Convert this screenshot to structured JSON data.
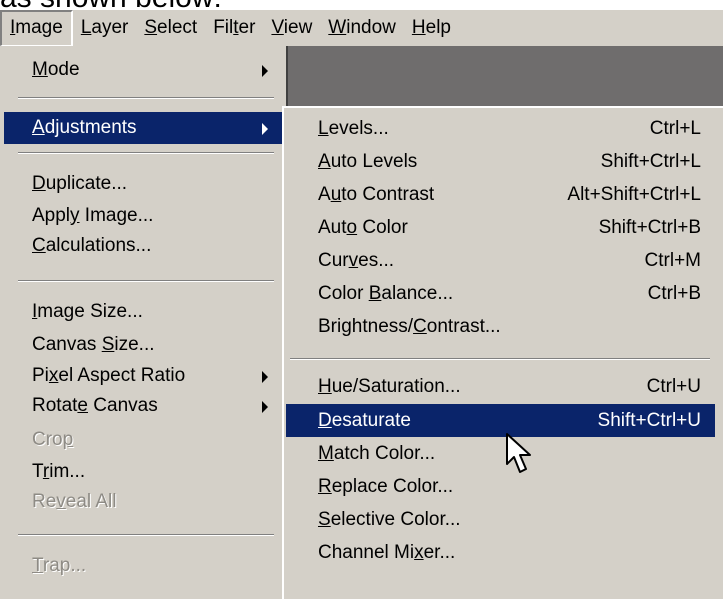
{
  "caption": "as shown below:",
  "menubar": {
    "items": [
      {
        "before": "",
        "key": "I",
        "after": "mage"
      },
      {
        "before": "",
        "key": "L",
        "after": "ayer"
      },
      {
        "before": "",
        "key": "S",
        "after": "elect"
      },
      {
        "before": "Fil",
        "key": "t",
        "after": "er"
      },
      {
        "before": "",
        "key": "V",
        "after": "iew"
      },
      {
        "before": "",
        "key": "W",
        "after": "indow"
      },
      {
        "before": "",
        "key": "H",
        "after": "elp"
      }
    ]
  },
  "image_menu": {
    "items": [
      {
        "before": "",
        "key": "M",
        "after": "ode",
        "submenu": true
      },
      {
        "before": "",
        "key": "A",
        "after": "djustments",
        "submenu": true,
        "highlighted": true
      },
      {
        "before": "",
        "key": "D",
        "after": "uplicate..."
      },
      {
        "before": "Appl",
        "key": "y",
        "after": " Image..."
      },
      {
        "before": "",
        "key": "C",
        "after": "alculations..."
      },
      {
        "before": "",
        "key": "I",
        "after": "mage Size..."
      },
      {
        "before": "Canvas ",
        "key": "S",
        "after": "ize..."
      },
      {
        "before": "Pi",
        "key": "x",
        "after": "el Aspect Ratio",
        "submenu": true
      },
      {
        "before": "Rotat",
        "key": "e",
        "after": " Canvas",
        "submenu": true
      },
      {
        "before": "Cro",
        "key": "p",
        "after": "",
        "disabled": true
      },
      {
        "before": "T",
        "key": "r",
        "after": "im..."
      },
      {
        "before": "Re",
        "key": "v",
        "after": "eal All",
        "disabled": true
      },
      {
        "before": "",
        "key": "T",
        "after": "rap...",
        "disabled": true
      }
    ]
  },
  "adjustments_menu": {
    "items": [
      {
        "before": "",
        "key": "L",
        "after": "evels...",
        "shortcut": "Ctrl+L"
      },
      {
        "before": "",
        "key": "A",
        "after": "uto Levels",
        "shortcut": "Shift+Ctrl+L"
      },
      {
        "before": "A",
        "key": "u",
        "after": "to Contrast",
        "shortcut": "Alt+Shift+Ctrl+L"
      },
      {
        "before": "Aut",
        "key": "o",
        "after": " Color",
        "shortcut": "Shift+Ctrl+B"
      },
      {
        "before": "Cur",
        "key": "v",
        "after": "es...",
        "shortcut": "Ctrl+M"
      },
      {
        "before": "Color ",
        "key": "B",
        "after": "alance...",
        "shortcut": "Ctrl+B"
      },
      {
        "before": "Brightness/",
        "key": "C",
        "after": "ontrast...",
        "shortcut": ""
      },
      {
        "before": "",
        "key": "H",
        "after": "ue/Saturation...",
        "shortcut": "Ctrl+U"
      },
      {
        "before": "",
        "key": "D",
        "after": "esaturate",
        "shortcut": "Shift+Ctrl+U",
        "highlighted": true
      },
      {
        "before": "",
        "key": "M",
        "after": "atch Color...",
        "shortcut": ""
      },
      {
        "before": "",
        "key": "R",
        "after": "eplace Color...",
        "shortcut": ""
      },
      {
        "before": "",
        "key": "S",
        "after": "elective Color...",
        "shortcut": ""
      },
      {
        "before": "Channel Mi",
        "key": "x",
        "after": "er...",
        "shortcut": ""
      }
    ]
  },
  "colors": {
    "menu_bg": "#d4d0c8",
    "highlight": "#0a246a",
    "dark_area": "#6f6d6d"
  },
  "icons": {
    "cursor": "arrow-pointer-icon",
    "submenu": "triangle-right-icon"
  }
}
